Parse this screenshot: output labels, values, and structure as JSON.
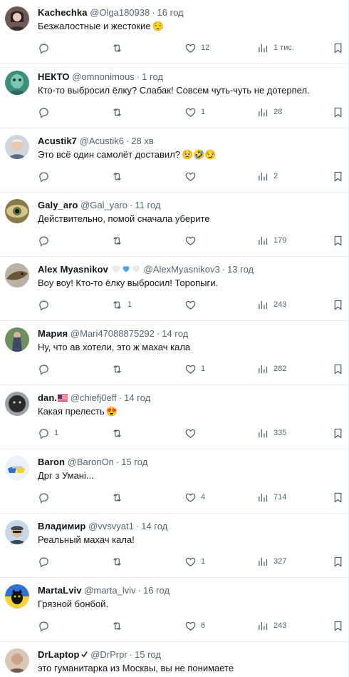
{
  "tweets": [
    {
      "name": "Kachechka",
      "handle": "@Olga180938",
      "time": "16 год",
      "text": "Безжалостные и жестокие",
      "emoji": "😌",
      "reply": "",
      "retweet": "",
      "like": "12",
      "views": "1 тис."
    },
    {
      "name": "НЕКТО",
      "handle": "@omnonimous",
      "time": "1 год",
      "text": "Кто-то выбросил ёлку? Слабак! Совсем чуть-чуть не дотерпел.",
      "reply": "",
      "retweet": "",
      "like": "1",
      "views": "28"
    },
    {
      "name": "Acustik7",
      "handle": "@Acustik6",
      "time": "28 хв",
      "text": "Это всё один самолёт доставил?",
      "emoji": "😟🤣😏",
      "reply": "",
      "retweet": "",
      "like": "",
      "views": "2"
    },
    {
      "name": "Galy_aro",
      "handle": "@Gal_yaro",
      "time": "11 год",
      "text": "Действительно, помой сначала уберите",
      "reply": "",
      "retweet": "",
      "like": "",
      "views": "179"
    },
    {
      "name": "Alex Myasnikov",
      "handle": "@AlexMyasnikov3",
      "time": "13 год",
      "text": "Воу воу! Кто-то ёлку выбросил! Торопыги.",
      "reply": "",
      "retweet": "1",
      "like": "",
      "views": "243"
    },
    {
      "name": "Мария",
      "handle": "@Mari47088875292",
      "time": "14 год",
      "text": "Ну, что ав хотели, это ж махач кала",
      "reply": "",
      "retweet": "",
      "like": "1",
      "views": "282"
    },
    {
      "name": "dan.",
      "handle": "@chiefj0eff",
      "time": "14 год",
      "text": "Какая прелесть",
      "emoji": "😍",
      "reply": "1",
      "retweet": "",
      "like": "",
      "views": "335"
    },
    {
      "name": "Baron",
      "handle": "@BaronOn",
      "time": "15 год",
      "text": "Дрг з Умані...",
      "reply": "",
      "retweet": "",
      "like": "4",
      "views": "714"
    },
    {
      "name": "Владимир",
      "handle": "@vvsvyat1",
      "time": "14 год",
      "text": "Реальный махач кала!",
      "reply": "",
      "retweet": "",
      "like": "1",
      "views": "327"
    },
    {
      "name": "MartaLviv",
      "handle": "@marta_lviv",
      "time": "16 год",
      "text": "Грязной бонбой.",
      "reply": "",
      "retweet": "",
      "like": "6",
      "views": "243"
    },
    {
      "name": "DrLaptop",
      "handle": "@DrPrpr",
      "time": "15 год",
      "text": "это гуманитарка из Москвы, вы не понимаете",
      "reply": "",
      "retweet": "",
      "like": "",
      "views": ""
    }
  ],
  "separator": "·",
  "colors": {
    "text": "#0f1419",
    "muted": "#536471",
    "divider": "#e9ecef",
    "heart_blue": "#4aa3e8",
    "heart_white": "#e8ecef"
  }
}
